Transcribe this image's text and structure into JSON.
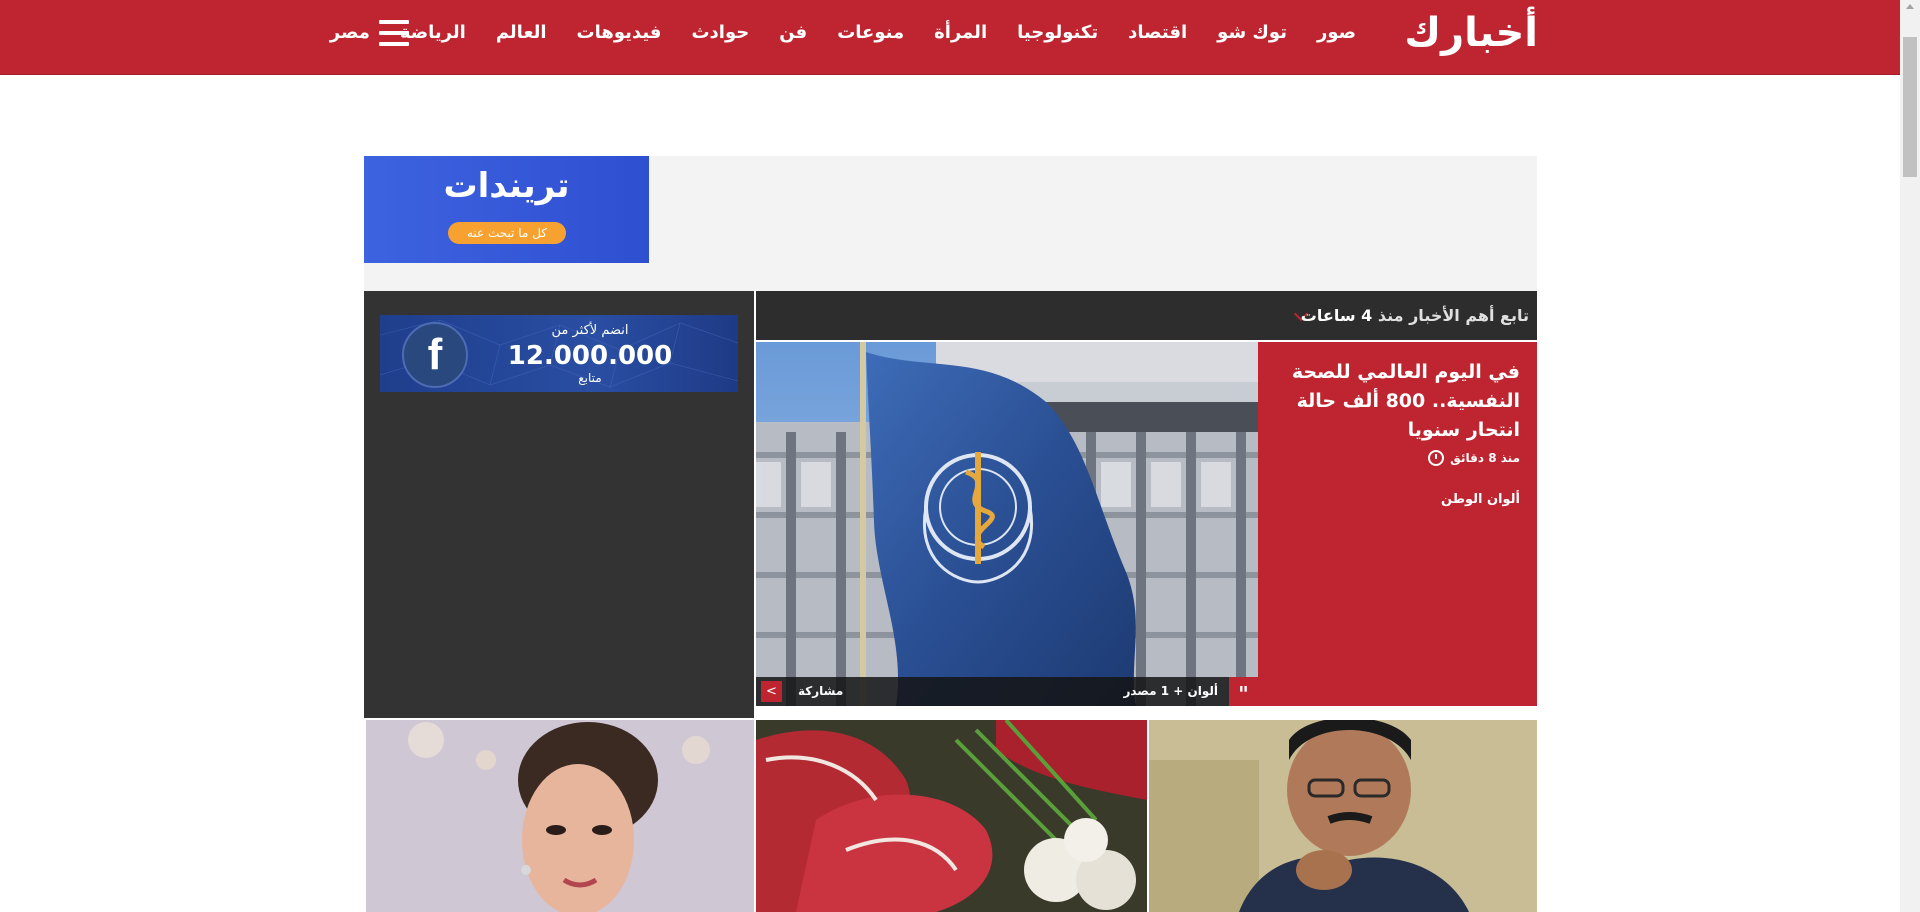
{
  "header": {
    "logo_text": "أخبارك",
    "nav": [
      "مصر",
      "الرياضة",
      "العالم",
      "فيديوهات",
      "حوادث",
      "فن",
      "منوعات",
      "المرأة",
      "تكنولوجيا",
      "اقتصاد",
      "توك شو",
      "صور"
    ],
    "menu_icon": "hamburger-icon"
  },
  "trends_ad": {
    "title": "تريندات",
    "tagline": "كل ما تبحث عنه"
  },
  "facebook_banner": {
    "top_text": "انضم لأكثر من",
    "count": "12.000.000",
    "bottom_text": "متابع"
  },
  "ticker": {
    "prefix": "تابع أهم الأخبار منذ",
    "highlight": "4 ساعات"
  },
  "hero": {
    "title": "في اليوم العالمي للصحة النفسية.. 800 ألف حالة انتحار سنويا",
    "time": "منذ 8 دقائق",
    "source": "ألوان الوطن",
    "source_count": "ألوان + 1 مصدر",
    "share_label": "مشاركة"
  },
  "colors": {
    "brand_red": "#bf2530",
    "dark_panel": "#333333",
    "ticker_bg": "#2d2d2d"
  }
}
